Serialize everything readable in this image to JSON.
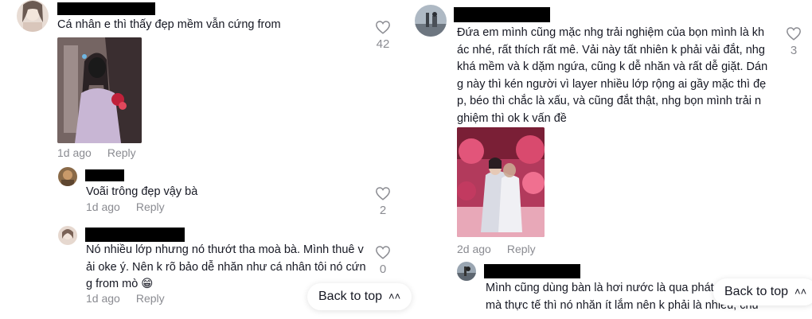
{
  "left_column": {
    "comment": {
      "text": "Cá nhân e thì thấy đẹp mềm vẫn cứng from",
      "likes": "42",
      "time": "1d ago",
      "reply_label": "Reply"
    },
    "replies": [
      {
        "text": "Voãi trông đẹp vậy bà",
        "likes": "2",
        "time": "1d ago",
        "reply_label": "Reply"
      },
      {
        "text_lines": [
          "Nó nhiều lớp nhưng nó thướt tha moà bà. Mình thuê v",
          "ải oke ý. Nên k rõ bảo dễ nhăn như cá nhân tôi nó cứn",
          "g from mò 😁"
        ],
        "likes": "0",
        "time": "1d ago",
        "reply_label": "Reply"
      }
    ]
  },
  "right_column": {
    "comment": {
      "text_lines": [
        "Đứa em mình cũng mặc nhg trải nghiệm của bọn mình là kh",
        "ác nhé, rất thích rất mê. Vải này tất nhiên k phải vải đắt, nhg",
        "khá mềm và k dặm ngứa, cũng k dễ nhăn và rất dễ giặt. Dán",
        "g này thì kén người vì layer nhiều lớp rộng ai gầy mặc thì đẹ",
        "p, béo thì chắc là xấu, và cũng đắt thật, nhg bọn mình trải n",
        "ghiệm thì ok k vấn đề"
      ],
      "likes": "3",
      "time": "2d ago",
      "reply_label": "Reply"
    },
    "reply": {
      "text_lines": [
        "Mình cũng dùng bàn là hơi nước là qua phát",
        "mà thực tế thì nó nhăn ít lắm nên k phải là nhiều, chủ"
      ]
    }
  },
  "back_to_top": {
    "label": "Back to top",
    "icon": "double-chevron-up-icon"
  },
  "colors": {
    "text": "#161823",
    "meta": "#8a8b91",
    "redaction": "#000000"
  }
}
